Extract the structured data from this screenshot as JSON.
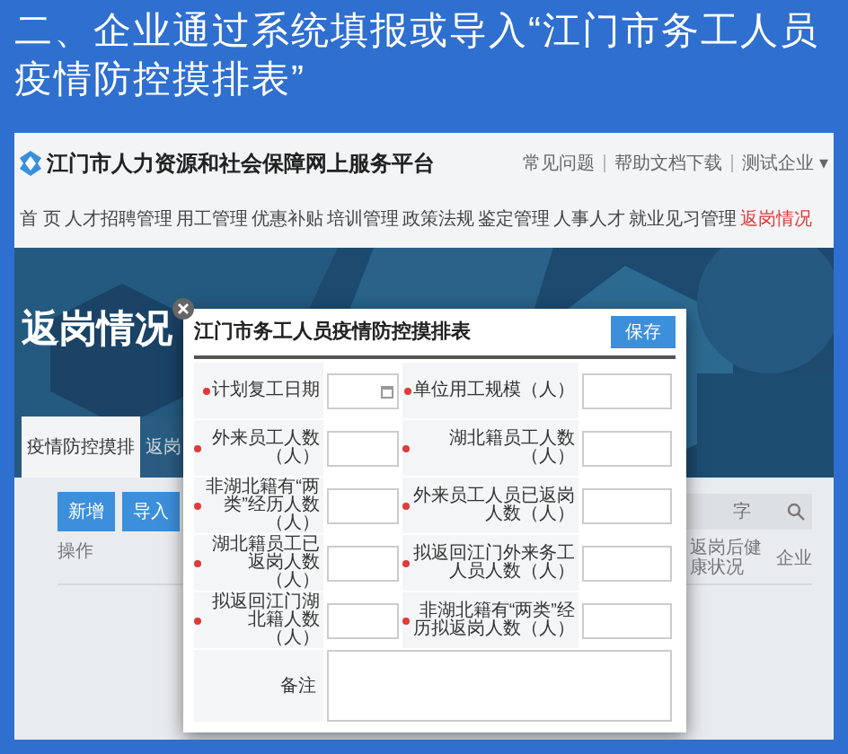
{
  "slide_title": "二、企业通过系统填报或导入“江门市务工人员疫情防控摸排表”",
  "site": {
    "title": "江门市人力资源和社会保障网上服务平台",
    "top_links": [
      "常见问题",
      "帮助文档下载",
      "测试企业 ▾"
    ]
  },
  "nav": [
    {
      "label": "首 页",
      "selected": false
    },
    {
      "label": "人才招聘管理",
      "selected": false
    },
    {
      "label": "用工管理",
      "selected": false
    },
    {
      "label": "优惠补贴",
      "selected": false
    },
    {
      "label": "培训管理",
      "selected": false
    },
    {
      "label": "政策法规",
      "selected": false
    },
    {
      "label": "鉴定管理",
      "selected": false
    },
    {
      "label": "人事人才",
      "selected": false
    },
    {
      "label": "就业见习管理",
      "selected": false
    },
    {
      "label": "返岗情况",
      "selected": true
    }
  ],
  "hero_title": "返岗情况",
  "tabs": [
    {
      "label": "疫情防控摸排",
      "selected": true
    },
    {
      "label": "返岗",
      "selected": false
    }
  ],
  "buttons": [
    "新增",
    "导入"
  ],
  "search": {
    "placeholder": "字"
  },
  "table": {
    "columns": [
      "操作",
      "返岗后健康状况",
      "企业"
    ]
  },
  "modal": {
    "title": "江门市务工人员疫情防控摸排表",
    "save": "保存",
    "fields": [
      {
        "label": "计划复工日期",
        "required": true,
        "kind": "date"
      },
      {
        "label": "单位用工规模（人）",
        "required": true,
        "kind": "number"
      },
      {
        "label": "外来员工人数（人）",
        "required": true,
        "kind": "number"
      },
      {
        "label": "湖北籍员工人数（人）",
        "required": true,
        "kind": "number"
      },
      {
        "label": "非湖北籍有“两类”经历人数（人）",
        "required": true,
        "kind": "number"
      },
      {
        "label": "外来员工人员已返岗人数（人）",
        "required": true,
        "kind": "number"
      },
      {
        "label": "湖北籍员工已返岗人数（人）",
        "required": true,
        "kind": "number"
      },
      {
        "label": "拟返回江门外来务工人员人数（人）",
        "required": true,
        "kind": "number"
      },
      {
        "label": "拟返回江门湖北籍人数（人）",
        "required": true,
        "kind": "number"
      },
      {
        "label": "非湖北籍有“两类”经历拟返岗人数（人）",
        "required": true,
        "kind": "number"
      }
    ],
    "remark": {
      "label": "备注"
    }
  }
}
